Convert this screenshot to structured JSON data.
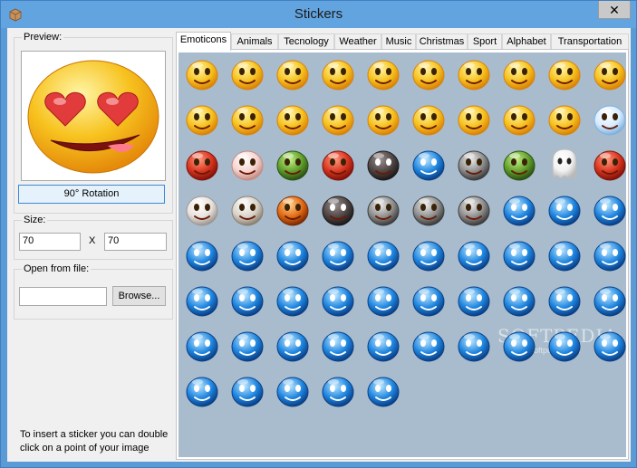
{
  "window": {
    "title": "Stickers",
    "close_glyph": "✕",
    "app_icon": "package-icon"
  },
  "preview": {
    "label": "Preview:",
    "rotation_button": "90° Rotation"
  },
  "size": {
    "label": "Size:",
    "width": "70",
    "separator": "X",
    "height": "70"
  },
  "open_file": {
    "label": "Open from file:",
    "path": "",
    "browse_button": "Browse..."
  },
  "hint": "To insert a sticker you can double click on a point of your image",
  "tabs": [
    {
      "label": "Emoticons",
      "active": true
    },
    {
      "label": "Animals"
    },
    {
      "label": "Tecnology"
    },
    {
      "label": "Weather"
    },
    {
      "label": "Music"
    },
    {
      "label": "Christmas"
    },
    {
      "label": "Sport"
    },
    {
      "label": "Alphabet"
    },
    {
      "label": "Transportation"
    }
  ],
  "stickers": [
    {
      "name": "heart-eyes-face-icon",
      "kind": "yellow"
    },
    {
      "name": "sunglasses-face-icon",
      "kind": "yellow"
    },
    {
      "name": "crying-face-icon",
      "kind": "yellow"
    },
    {
      "name": "smiling-face-icon",
      "kind": "yellow"
    },
    {
      "name": "grinning-face-icon",
      "kind": "yellow"
    },
    {
      "name": "big-smile-face-icon",
      "kind": "yellow"
    },
    {
      "name": "winking-face-icon",
      "kind": "yellow"
    },
    {
      "name": "laughing-face-icon",
      "kind": "yellow"
    },
    {
      "name": "cool-glasses-face-icon",
      "kind": "yellow"
    },
    {
      "name": "nerd-glasses-face-icon",
      "kind": "yellow"
    },
    {
      "name": "blushing-face-icon",
      "kind": "yellow"
    },
    {
      "name": "shy-face-icon",
      "kind": "yellow"
    },
    {
      "name": "embarrassed-face-icon",
      "kind": "yellow"
    },
    {
      "name": "sick-face-icon",
      "kind": "yellow"
    },
    {
      "name": "sleepy-face-icon",
      "kind": "yellow"
    },
    {
      "name": "suspicious-face-icon",
      "kind": "yellow"
    },
    {
      "name": "angry-face-icon",
      "kind": "yellow"
    },
    {
      "name": "teeth-grin-face-icon",
      "kind": "yellow"
    },
    {
      "name": "goofy-glasses-face-icon",
      "kind": "yellow"
    },
    {
      "name": "angel-face-icon",
      "kind": "pale"
    },
    {
      "name": "devil-face-icon",
      "kind": "red"
    },
    {
      "name": "skull-bandage-face-icon",
      "kind": "pink"
    },
    {
      "name": "witch-face-icon",
      "kind": "green"
    },
    {
      "name": "red-devil-face-icon",
      "kind": "red"
    },
    {
      "name": "vampire-face-icon",
      "kind": "dark"
    },
    {
      "name": "cyclops-face-icon",
      "kind": "blue"
    },
    {
      "name": "gray-cat-face-icon",
      "kind": "gray"
    },
    {
      "name": "frankenstein-face-icon",
      "kind": "green"
    },
    {
      "name": "ghost-icon",
      "kind": "ghost"
    },
    {
      "name": "red-monster-face-icon",
      "kind": "red"
    },
    {
      "name": "hockey-mask-face-icon",
      "kind": "mask"
    },
    {
      "name": "mummy-face-icon",
      "kind": "mummy"
    },
    {
      "name": "pumpkin-face-icon",
      "kind": "orange"
    },
    {
      "name": "dark-glowing-eyes-face-icon",
      "kind": "dark"
    },
    {
      "name": "zombie-face-icon",
      "kind": "gray"
    },
    {
      "name": "skull-face-icon",
      "kind": "gray"
    },
    {
      "name": "alien-face-icon",
      "kind": "gray"
    },
    {
      "name": "blue-grin-face-icon",
      "kind": "blue"
    },
    {
      "name": "blue-teeth-face-icon",
      "kind": "blue"
    },
    {
      "name": "blue-scream-face-icon",
      "kind": "blue"
    },
    {
      "name": "blue-frown-face-icon",
      "kind": "blue"
    },
    {
      "name": "blue-worried-face-icon",
      "kind": "blue"
    },
    {
      "name": "blue-angry-face-icon",
      "kind": "blue"
    },
    {
      "name": "blue-laugh-face-icon",
      "kind": "blue"
    },
    {
      "name": "blue-hearts-face-icon",
      "kind": "blue"
    },
    {
      "name": "blue-big-grin-face-icon",
      "kind": "blue"
    },
    {
      "name": "blue-sad-face-icon",
      "kind": "blue"
    },
    {
      "name": "blue-smirk-face-icon",
      "kind": "blue"
    },
    {
      "name": "blue-shock-face-icon",
      "kind": "blue"
    },
    {
      "name": "blue-toothy-face-icon",
      "kind": "blue"
    },
    {
      "name": "blue-smile-face-icon",
      "kind": "blue"
    },
    {
      "name": "blue-nervous-face-icon",
      "kind": "blue"
    },
    {
      "name": "blue-happy-face-icon",
      "kind": "blue"
    },
    {
      "name": "blue-shout-face-icon",
      "kind": "blue"
    },
    {
      "name": "blue-wide-eyes-face-icon",
      "kind": "blue"
    },
    {
      "name": "blue-grumpy-face-icon",
      "kind": "blue"
    },
    {
      "name": "blue-squint-face-icon",
      "kind": "blue"
    },
    {
      "name": "blue-giggle-face-icon",
      "kind": "blue"
    },
    {
      "name": "blue-surprised-face-icon",
      "kind": "blue"
    },
    {
      "name": "blue-mad-face-icon",
      "kind": "blue"
    },
    {
      "name": "blue-startled-face-icon",
      "kind": "blue"
    },
    {
      "name": "blue-content-face-icon",
      "kind": "blue"
    },
    {
      "name": "blue-grimace-face-icon",
      "kind": "blue"
    },
    {
      "name": "blue-star-eyes-face-icon",
      "kind": "blue"
    },
    {
      "name": "blue-goggle-eyes-face-icon",
      "kind": "blue"
    },
    {
      "name": "blue-calm-face-icon",
      "kind": "blue"
    },
    {
      "name": "blue-sleepy-face-icon",
      "kind": "blue"
    },
    {
      "name": "blue-cheeky-face-icon",
      "kind": "blue"
    },
    {
      "name": "blue-evil-face-icon",
      "kind": "blue"
    },
    {
      "name": "blue-chatter-face-icon",
      "kind": "blue"
    },
    {
      "name": "blue-sigh-face-icon",
      "kind": "blue"
    },
    {
      "name": "blue-pout-face-icon",
      "kind": "blue"
    },
    {
      "name": "blue-sunglasses-face-icon",
      "kind": "blue"
    },
    {
      "name": "blue-tongue-face-icon",
      "kind": "blue"
    },
    {
      "name": "blue-bored-face-icon",
      "kind": "blue"
    }
  ],
  "watermark": "SOFTPEDIA",
  "watermark_sub": "www.softpedia.com"
}
